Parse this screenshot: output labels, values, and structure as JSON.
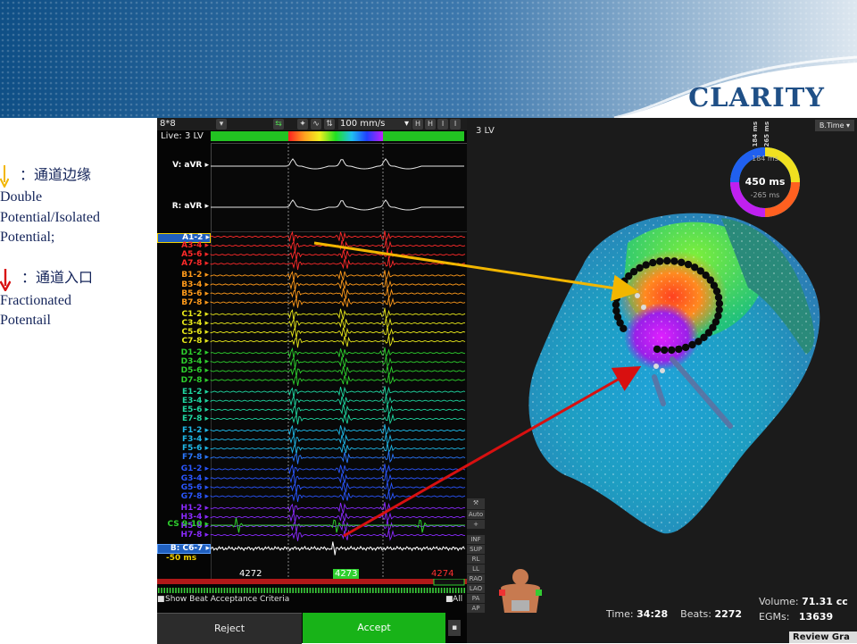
{
  "slide": {
    "brand_title": "CLARITY",
    "notes": [
      {
        "arrow_color": "#f2b600",
        "heading": "：通道边缘",
        "lines": [
          "Double",
          "Potential/Isolated",
          "Potential;"
        ]
      },
      {
        "arrow_color": "#d81010",
        "heading": "：通道入口",
        "lines": [
          "Fractionated",
          "Potentail"
        ]
      }
    ]
  },
  "ep_panel": {
    "grid_label": "8*8",
    "live_label": "Live: 3 LV",
    "sweep_speed": "100 mm/s",
    "ecg_leads": [
      {
        "label": "V: aVR"
      },
      {
        "label": "R: aVR"
      }
    ],
    "egm_leads": [
      {
        "label": "A1-2",
        "color": "#ff2a2a"
      },
      {
        "label": "A3-4",
        "color": "#ff2a2a"
      },
      {
        "label": "A5-6",
        "color": "#ff2a2a"
      },
      {
        "label": "A7-8",
        "color": "#ff2a2a"
      },
      {
        "label": "B1-2",
        "color": "#ff9a1a"
      },
      {
        "label": "B3-4",
        "color": "#ff9a1a"
      },
      {
        "label": "B5-6",
        "color": "#ff9a1a"
      },
      {
        "label": "B7-8",
        "color": "#ff9a1a"
      },
      {
        "label": "C1-2",
        "color": "#e8e81a"
      },
      {
        "label": "C3-4",
        "color": "#e8e81a"
      },
      {
        "label": "C5-6",
        "color": "#e8e81a"
      },
      {
        "label": "C7-8",
        "color": "#e8e81a"
      },
      {
        "label": "D1-2",
        "color": "#2ed02e"
      },
      {
        "label": "D3-4",
        "color": "#2ed02e"
      },
      {
        "label": "D5-6",
        "color": "#2ed02e"
      },
      {
        "label": "D7-8",
        "color": "#2ed02e"
      },
      {
        "label": "E1-2",
        "color": "#1fd6a0"
      },
      {
        "label": "E3-4",
        "color": "#1fd6a0"
      },
      {
        "label": "E5-6",
        "color": "#1fd6a0"
      },
      {
        "label": "E7-8",
        "color": "#1fd6a0"
      },
      {
        "label": "F1-2",
        "color": "#1fb8e8"
      },
      {
        "label": "F3-4",
        "color": "#1fb8e8"
      },
      {
        "label": "F5-6",
        "color": "#1fb8e8"
      },
      {
        "label": "F7-8",
        "color": "#2a78ff"
      },
      {
        "label": "G1-2",
        "color": "#2a56ff"
      },
      {
        "label": "G3-4",
        "color": "#2a56ff"
      },
      {
        "label": "G5-6",
        "color": "#2a56ff"
      },
      {
        "label": "G7-8",
        "color": "#2a56ff"
      },
      {
        "label": "H1-2",
        "color": "#8a2aff"
      },
      {
        "label": "H3-4",
        "color": "#8a2aff"
      },
      {
        "label": "H5-6",
        "color": "#8a2aff"
      },
      {
        "label": "H7-8",
        "color": "#8a2aff"
      }
    ],
    "cs_lead": {
      "label": "CS 9-10",
      "color": "#2ed02e"
    },
    "ref_lead": {
      "label": "B: C6-7",
      "color": "#ffffff"
    },
    "scale_label": "-50",
    "scale_unit": "ms",
    "cycle_lengths": [
      {
        "value": "4272",
        "color": "#ffffff"
      },
      {
        "value": "4273",
        "color": "#2ed02e"
      },
      {
        "value": "4274",
        "color": "#ff3030"
      }
    ],
    "beat_criteria_label": "Show Beat Acceptance Criteria",
    "all_label": "All",
    "reject_label": "Reject",
    "accept_label": "Accept"
  },
  "map_panel": {
    "title": "3 LV",
    "time_mode": "B.Time",
    "ring_top_labels": [
      "184 ms",
      "265 ms"
    ],
    "ring_values": {
      "upper": "184 ms",
      "center": "450 ms",
      "lower": "-265 ms"
    },
    "toolstrip": [
      "Auto",
      "INF",
      "SUP",
      "RL",
      "LL",
      "RAO",
      "LAO",
      "PA",
      "AP"
    ],
    "stats": {
      "time_label": "Time:",
      "time_value": "34:28",
      "beats_label": "Beats:",
      "beats_value": "2272",
      "volume_label": "Volume:",
      "volume_value": "71.31 cc",
      "egms_label": "EGMs:",
      "egms_value": "13639"
    },
    "review_label": "Review Gra"
  },
  "colors": {
    "accent_blue": "#1f4f86",
    "accept_green": "#18b318",
    "arrow_yellow": "#f2b600",
    "arrow_red": "#d81010"
  }
}
